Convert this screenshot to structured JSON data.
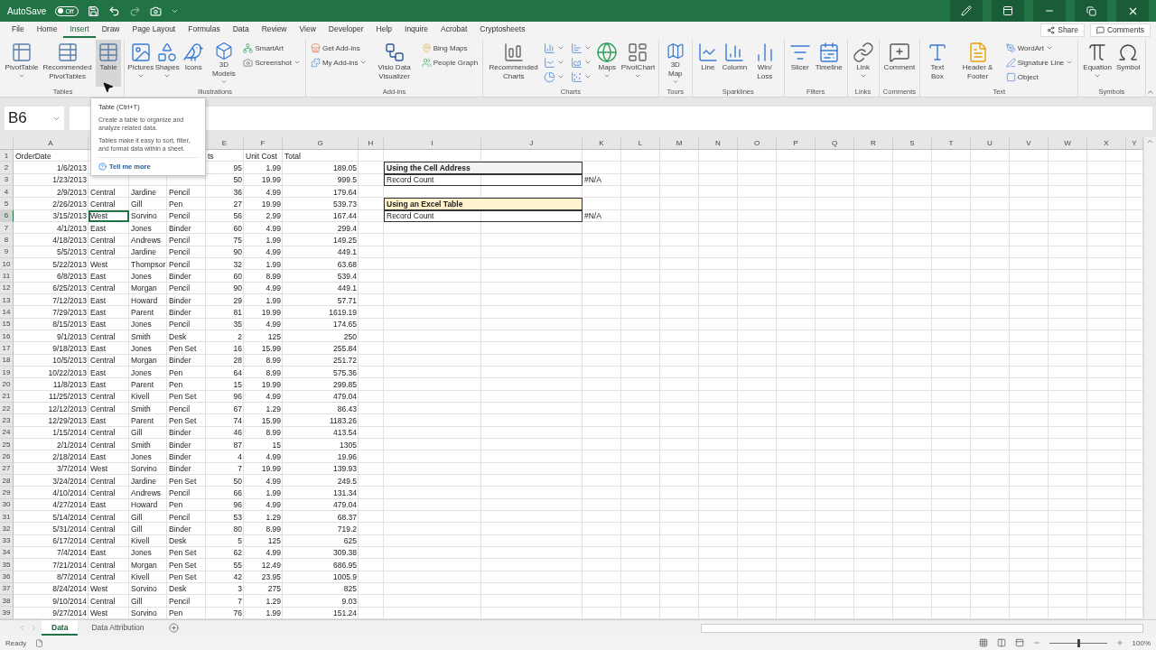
{
  "title_bar": {
    "autosave": {
      "label": "AutoSave",
      "state_text": "Off",
      "on": false
    }
  },
  "menu_tabs": [
    {
      "label": "File",
      "selected": false
    },
    {
      "label": "Home",
      "selected": false
    },
    {
      "label": "Insert",
      "selected": true
    },
    {
      "label": "Draw",
      "selected": false
    },
    {
      "label": "Page Layout",
      "selected": false
    },
    {
      "label": "Formulas",
      "selected": false
    },
    {
      "label": "Data",
      "selected": false
    },
    {
      "label": "Review",
      "selected": false
    },
    {
      "label": "View",
      "selected": false
    },
    {
      "label": "Developer",
      "selected": false
    },
    {
      "label": "Help",
      "selected": false
    },
    {
      "label": "Inquire",
      "selected": false
    },
    {
      "label": "Acrobat",
      "selected": false
    },
    {
      "label": "Cryptosheets",
      "selected": false
    }
  ],
  "share_button": "Share",
  "comments_button": "Comments",
  "ribbon": [
    {
      "label": "Tables",
      "buttons": [
        {
          "kind": "large",
          "label": "PivotTable",
          "dropdown": true,
          "hovered": false
        },
        {
          "kind": "large",
          "label": "Recommended PivotTables",
          "dropdown": false,
          "hovered": false
        },
        {
          "kind": "large",
          "label": "Table",
          "dropdown": false,
          "hovered": true
        }
      ]
    },
    {
      "label": "Illustrations",
      "buttons": [
        {
          "kind": "large",
          "label": "Pictures",
          "dropdown": true,
          "hovered": false
        },
        {
          "kind": "large",
          "label": "Shapes",
          "dropdown": true,
          "hovered": false
        },
        {
          "kind": "large",
          "label": "Icons",
          "dropdown": false,
          "hovered": false
        },
        {
          "kind": "large",
          "label": "3D Models",
          "dropdown": true,
          "hovered": false
        },
        {
          "kind": "small",
          "label": "SmartArt",
          "dropdown": false,
          "hovered": false
        },
        {
          "kind": "small",
          "label": "Screenshot",
          "dropdown": true,
          "hovered": false
        }
      ]
    },
    {
      "label": "Add-ins",
      "buttons": [
        {
          "kind": "small",
          "label": "Get Add-ins",
          "dropdown": false,
          "hovered": false
        },
        {
          "kind": "small",
          "label": "My Add-ins",
          "dropdown": true,
          "hovered": false
        },
        {
          "kind": "large",
          "label": "Visio Data Visualizer",
          "dropdown": false,
          "hovered": false
        },
        {
          "kind": "small",
          "label": "Bing Maps",
          "dropdown": false,
          "hovered": false
        },
        {
          "kind": "small",
          "label": "People Graph",
          "dropdown": false,
          "hovered": false
        }
      ]
    },
    {
      "label": "Charts",
      "buttons": [
        {
          "kind": "large",
          "label": "Recommended Charts",
          "dropdown": false,
          "hovered": false
        },
        {
          "kind": "icon",
          "dropdown": true,
          "hovered": false
        },
        {
          "kind": "icon",
          "dropdown": true,
          "hovered": false
        },
        {
          "kind": "icon",
          "dropdown": true,
          "hovered": false
        },
        {
          "kind": "icon",
          "dropdown": true,
          "hovered": false
        },
        {
          "kind": "icon",
          "dropdown": true,
          "hovered": false
        },
        {
          "kind": "icon",
          "dropdown": true,
          "hovered": false
        },
        {
          "kind": "large",
          "label": "Maps",
          "dropdown": true,
          "hovered": false
        },
        {
          "kind": "large",
          "label": "PivotChart",
          "dropdown": true,
          "hovered": false
        }
      ]
    },
    {
      "label": "Tours",
      "buttons": [
        {
          "kind": "large",
          "label": "3D Map",
          "dropdown": true,
          "hovered": false
        }
      ]
    },
    {
      "label": "Sparklines",
      "buttons": [
        {
          "kind": "large",
          "label": "Line",
          "dropdown": false,
          "hovered": false
        },
        {
          "kind": "large",
          "label": "Column",
          "dropdown": false,
          "hovered": false
        },
        {
          "kind": "large",
          "label": "Win/ Loss",
          "dropdown": false,
          "hovered": false
        }
      ]
    },
    {
      "label": "Filters",
      "buttons": [
        {
          "kind": "large",
          "label": "Slicer",
          "dropdown": false,
          "hovered": false
        },
        {
          "kind": "large",
          "label": "Timeline",
          "dropdown": false,
          "hovered": false
        }
      ]
    },
    {
      "label": "Links",
      "buttons": [
        {
          "kind": "large",
          "label": "Link",
          "dropdown": true,
          "hovered": false
        }
      ]
    },
    {
      "label": "Comments",
      "buttons": [
        {
          "kind": "large",
          "label": "Comment",
          "dropdown": false,
          "hovered": false
        }
      ]
    },
    {
      "label": "Text",
      "buttons": [
        {
          "kind": "large",
          "label": "Text Box",
          "dropdown": false,
          "hovered": false
        },
        {
          "kind": "large",
          "label": "Header & Footer",
          "dropdown": false,
          "hovered": false
        },
        {
          "kind": "small",
          "label": "WordArt",
          "dropdown": true,
          "hovered": false
        },
        {
          "kind": "small",
          "label": "Signature Line",
          "dropdown": true,
          "hovered": false
        },
        {
          "kind": "small",
          "label": "Object",
          "dropdown": false,
          "hovered": false
        }
      ]
    },
    {
      "label": "Symbols",
      "buttons": [
        {
          "kind": "large",
          "label": "Equation",
          "dropdown": true,
          "hovered": false
        },
        {
          "kind": "large",
          "label": "Symbol",
          "dropdown": false,
          "hovered": false
        }
      ]
    }
  ],
  "name_box": "B6",
  "tooltip": {
    "title": "Table (Ctrl+T)",
    "lines": [
      "Create a table to organize and analyze related data.",
      "Tables make it easy to sort, filter, and format data within a sheet."
    ],
    "link": "Tell me more"
  },
  "columns_left": [
    "A"
  ],
  "columns_right": [
    "E",
    "F",
    "G",
    "H",
    "I",
    "J",
    "K",
    "L",
    "M",
    "N",
    "O",
    "P",
    "Q",
    "R",
    "S",
    "T",
    "U",
    "V",
    "W",
    "X",
    "Y"
  ],
  "rows": [
    {
      "number": "1",
      "kind": "header",
      "selected": false,
      "date": "OrderDate",
      "units": "ts",
      "unit_cost": "Unit Cost",
      "total": "Total"
    },
    {
      "number": "2",
      "kind": "data",
      "selected": false,
      "date": "1/6/2013",
      "units": "95",
      "unit_cost": "1.99",
      "total": "189.05",
      "summary": {
        "kind": "heading",
        "text": "Using the Cell Address",
        "color": "#f2f2f2"
      }
    },
    {
      "number": "3",
      "kind": "data",
      "selected": false,
      "date": "1/23/2013",
      "units": "50",
      "unit_cost": "19.99",
      "total": "999.5",
      "summary": {
        "kind": "field",
        "text": "Record Count",
        "value": "#N/A"
      }
    },
    {
      "number": "4",
      "kind": "data",
      "selected": false,
      "date": "2/9/2013",
      "region": "Central",
      "rep": "Jardine",
      "item": "Pencil",
      "units": "36",
      "unit_cost": "4.99",
      "total": "179.64"
    },
    {
      "number": "5",
      "kind": "data",
      "selected": false,
      "date": "2/26/2013",
      "region": "Central",
      "rep": "Gill",
      "item": "Pen",
      "units": "27",
      "unit_cost": "19.99",
      "total": "539.73",
      "summary": {
        "kind": "heading",
        "text": "Using an Excel Table",
        "color": "#fff2cc"
      }
    },
    {
      "number": "6",
      "kind": "data",
      "selected": true,
      "date": "3/15/2013",
      "region": "West",
      "rep": "Sorvino",
      "item": "Pencil",
      "units": "56",
      "unit_cost": "2.99",
      "total": "167.44",
      "summary": {
        "kind": "field",
        "text": "Record Count",
        "value": "#N/A"
      }
    },
    {
      "number": "7",
      "kind": "data",
      "selected": false,
      "date": "4/1/2013",
      "region": "East",
      "rep": "Jones",
      "item": "Binder",
      "units": "60",
      "unit_cost": "4.99",
      "total": "299.4"
    },
    {
      "number": "8",
      "kind": "data",
      "selected": false,
      "date": "4/18/2013",
      "region": "Central",
      "rep": "Andrews",
      "item": "Pencil",
      "units": "75",
      "unit_cost": "1.99",
      "total": "149.25"
    },
    {
      "number": "9",
      "kind": "data",
      "selected": false,
      "date": "5/5/2013",
      "region": "Central",
      "rep": "Jardine",
      "item": "Pencil",
      "units": "90",
      "unit_cost": "4.99",
      "total": "449.1"
    },
    {
      "number": "10",
      "kind": "data",
      "selected": false,
      "date": "5/22/2013",
      "region": "West",
      "rep": "Thompsor",
      "item": "Pencil",
      "units": "32",
      "unit_cost": "1.99",
      "total": "63.68"
    },
    {
      "number": "11",
      "kind": "data",
      "selected": false,
      "date": "6/8/2013",
      "region": "East",
      "rep": "Jones",
      "item": "Binder",
      "units": "60",
      "unit_cost": "8.99",
      "total": "539.4"
    },
    {
      "number": "12",
      "kind": "data",
      "selected": false,
      "date": "6/25/2013",
      "region": "Central",
      "rep": "Morgan",
      "item": "Pencil",
      "units": "90",
      "unit_cost": "4.99",
      "total": "449.1"
    },
    {
      "number": "13",
      "kind": "data",
      "selected": false,
      "date": "7/12/2013",
      "region": "East",
      "rep": "Howard",
      "item": "Binder",
      "units": "29",
      "unit_cost": "1.99",
      "total": "57.71"
    },
    {
      "number": "14",
      "kind": "data",
      "selected": false,
      "date": "7/29/2013",
      "region": "East",
      "rep": "Parent",
      "item": "Binder",
      "units": "81",
      "unit_cost": "19.99",
      "total": "1619.19"
    },
    {
      "number": "15",
      "kind": "data",
      "selected": false,
      "date": "8/15/2013",
      "region": "East",
      "rep": "Jones",
      "item": "Pencil",
      "units": "35",
      "unit_cost": "4.99",
      "total": "174.65"
    },
    {
      "number": "16",
      "kind": "data",
      "selected": false,
      "date": "9/1/2013",
      "region": "Central",
      "rep": "Smith",
      "item": "Desk",
      "units": "2",
      "unit_cost": "125",
      "total": "250"
    },
    {
      "number": "17",
      "kind": "data",
      "selected": false,
      "date": "9/18/2013",
      "region": "East",
      "rep": "Jones",
      "item": "Pen Set",
      "units": "16",
      "unit_cost": "15.99",
      "total": "255.84"
    },
    {
      "number": "18",
      "kind": "data",
      "selected": false,
      "date": "10/5/2013",
      "region": "Central",
      "rep": "Morgan",
      "item": "Binder",
      "units": "28",
      "unit_cost": "8.99",
      "total": "251.72"
    },
    {
      "number": "19",
      "kind": "data",
      "selected": false,
      "date": "10/22/2013",
      "region": "East",
      "rep": "Jones",
      "item": "Pen",
      "units": "64",
      "unit_cost": "8.99",
      "total": "575.36"
    },
    {
      "number": "20",
      "kind": "data",
      "selected": false,
      "date": "11/8/2013",
      "region": "East",
      "rep": "Parent",
      "item": "Pen",
      "units": "15",
      "unit_cost": "19.99",
      "total": "299.85"
    },
    {
      "number": "21",
      "kind": "data",
      "selected": false,
      "date": "11/25/2013",
      "region": "Central",
      "rep": "Kivell",
      "item": "Pen Set",
      "units": "96",
      "unit_cost": "4.99",
      "total": "479.04"
    },
    {
      "number": "22",
      "kind": "data",
      "selected": false,
      "date": "12/12/2013",
      "region": "Central",
      "rep": "Smith",
      "item": "Pencil",
      "units": "67",
      "unit_cost": "1.29",
      "total": "86.43"
    },
    {
      "number": "23",
      "kind": "data",
      "selected": false,
      "date": "12/29/2013",
      "region": "East",
      "rep": "Parent",
      "item": "Pen Set",
      "units": "74",
      "unit_cost": "15.99",
      "total": "1183.26"
    },
    {
      "number": "24",
      "kind": "data",
      "selected": false,
      "date": "1/15/2014",
      "region": "Central",
      "rep": "Gill",
      "item": "Binder",
      "units": "46",
      "unit_cost": "8.99",
      "total": "413.54"
    },
    {
      "number": "25",
      "kind": "data",
      "selected": false,
      "date": "2/1/2014",
      "region": "Central",
      "rep": "Smith",
      "item": "Binder",
      "units": "87",
      "unit_cost": "15",
      "total": "1305"
    },
    {
      "number": "26",
      "kind": "data",
      "selected": false,
      "date": "2/18/2014",
      "region": "East",
      "rep": "Jones",
      "item": "Binder",
      "units": "4",
      "unit_cost": "4.99",
      "total": "19.96"
    },
    {
      "number": "27",
      "kind": "data",
      "selected": false,
      "date": "3/7/2014",
      "region": "West",
      "rep": "Sorvino",
      "item": "Binder",
      "units": "7",
      "unit_cost": "19.99",
      "total": "139.93"
    },
    {
      "number": "28",
      "kind": "data",
      "selected": false,
      "date": "3/24/2014",
      "region": "Central",
      "rep": "Jardine",
      "item": "Pen Set",
      "units": "50",
      "unit_cost": "4.99",
      "total": "249.5"
    },
    {
      "number": "29",
      "kind": "data",
      "selected": false,
      "date": "4/10/2014",
      "region": "Central",
      "rep": "Andrews",
      "item": "Pencil",
      "units": "66",
      "unit_cost": "1.99",
      "total": "131.34"
    },
    {
      "number": "30",
      "kind": "data",
      "selected": false,
      "date": "4/27/2014",
      "region": "East",
      "rep": "Howard",
      "item": "Pen",
      "units": "96",
      "unit_cost": "4.99",
      "total": "479.04"
    },
    {
      "number": "31",
      "kind": "data",
      "selected": false,
      "date": "5/14/2014",
      "region": "Central",
      "rep": "Gill",
      "item": "Pencil",
      "units": "53",
      "unit_cost": "1.29",
      "total": "68.37"
    },
    {
      "number": "32",
      "kind": "data",
      "selected": false,
      "date": "5/31/2014",
      "region": "Central",
      "rep": "Gill",
      "item": "Binder",
      "units": "80",
      "unit_cost": "8.99",
      "total": "719.2"
    },
    {
      "number": "33",
      "kind": "data",
      "selected": false,
      "date": "6/17/2014",
      "region": "Central",
      "rep": "Kivell",
      "item": "Desk",
      "units": "5",
      "unit_cost": "125",
      "total": "625"
    },
    {
      "number": "34",
      "kind": "data",
      "selected": false,
      "date": "7/4/2014",
      "region": "East",
      "rep": "Jones",
      "item": "Pen Set",
      "units": "62",
      "unit_cost": "4.99",
      "total": "309.38"
    },
    {
      "number": "35",
      "kind": "data",
      "selected": false,
      "date": "7/21/2014",
      "region": "Central",
      "rep": "Morgan",
      "item": "Pen Set",
      "units": "55",
      "unit_cost": "12.49",
      "total": "686.95"
    },
    {
      "number": "36",
      "kind": "data",
      "selected": false,
      "date": "8/7/2014",
      "region": "Central",
      "rep": "Kivell",
      "item": "Pen Set",
      "units": "42",
      "unit_cost": "23.95",
      "total": "1005.9"
    },
    {
      "number": "37",
      "kind": "data",
      "selected": false,
      "date": "8/24/2014",
      "region": "West",
      "rep": "Sorvino",
      "item": "Desk",
      "units": "3",
      "unit_cost": "275",
      "total": "825"
    },
    {
      "number": "38",
      "kind": "data",
      "selected": false,
      "date": "9/10/2014",
      "region": "Central",
      "rep": "Gill",
      "item": "Pencil",
      "units": "7",
      "unit_cost": "1.29",
      "total": "9.03"
    },
    {
      "number": "39",
      "kind": "data",
      "selected": false,
      "date": "9/27/2014",
      "region": "West",
      "rep": "Sorvino",
      "item": "Pen",
      "units": "76",
      "unit_cost": "1.99",
      "total": "151.24"
    }
  ],
  "sheet_tabs": [
    {
      "label": "Data",
      "selected": true
    },
    {
      "label": "Data Attribution",
      "selected": false
    }
  ],
  "status_bar": {
    "text": "Ready",
    "zoom": {
      "level": 0.5,
      "text": "100%"
    }
  }
}
